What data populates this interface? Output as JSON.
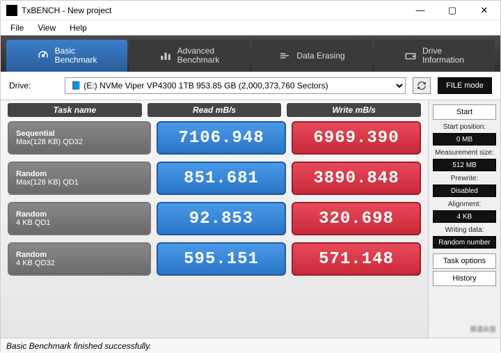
{
  "window": {
    "title": "TxBENCH - New project",
    "min": "—",
    "max": "▢",
    "close": "✕"
  },
  "menu": {
    "file": "File",
    "view": "View",
    "help": "Help"
  },
  "tabs": {
    "basic": "Basic\nBenchmark",
    "advanced": "Advanced\nBenchmark",
    "erasing": "Data Erasing",
    "driveinfo": "Drive\nInformation"
  },
  "drive": {
    "label": "Drive:",
    "selected": "📘 (E:) NVMe Viper VP4300 1TB   953.85 GB (2,000,373,760 Sectors)",
    "filemode": "FILE mode"
  },
  "headers": {
    "task": "Task name",
    "read": "Read mB/s",
    "write": "Write mB/s"
  },
  "rows": [
    {
      "task1": "Sequential",
      "task2": "Max(128 KB) QD32",
      "read": "7106.948",
      "write": "6969.390"
    },
    {
      "task1": "Random",
      "task2": "Max(128 KB) QD1",
      "read": "851.681",
      "write": "3890.848"
    },
    {
      "task1": "Random",
      "task2": "4 KB QD1",
      "read": "92.853",
      "write": "320.698"
    },
    {
      "task1": "Random",
      "task2": "4 KB QD32",
      "read": "595.151",
      "write": "571.148"
    }
  ],
  "sidebar": {
    "start": "Start",
    "startpos_label": "Start position:",
    "startpos_val": "0 MB",
    "meas_label": "Measurement size:",
    "meas_val": "512 MB",
    "prewrite_label": "Prewrite:",
    "prewrite_val": "Disabled",
    "align_label": "Alignment:",
    "align_val": "4 KB",
    "writing_label": "Writing data:",
    "writing_val": "Random number",
    "taskopt": "Task options",
    "history": "History"
  },
  "status": "Basic Benchmark finished successfully.",
  "watermark": "新浪众测"
}
